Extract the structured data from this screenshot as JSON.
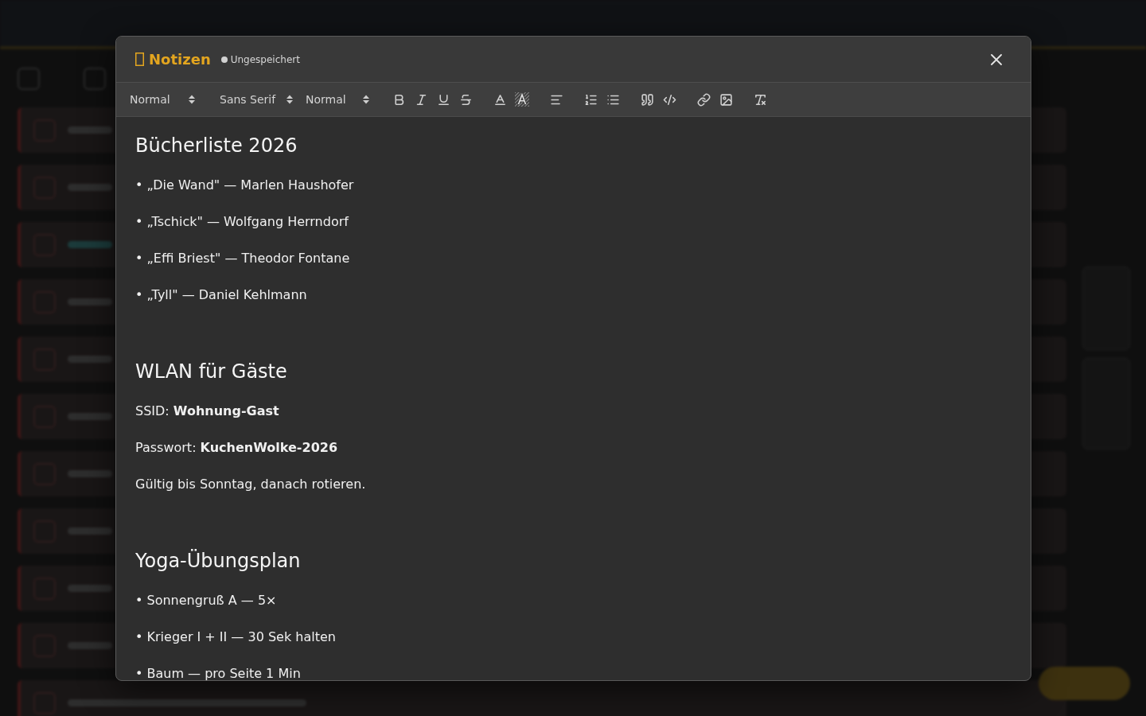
{
  "modal": {
    "title": "Notizen",
    "status": "Ungespeichert",
    "toolbar": {
      "pickers": [
        {
          "kind": "header",
          "value": "Normal"
        },
        {
          "kind": "font",
          "value": "Sans Serif"
        },
        {
          "kind": "size",
          "value": "Normal"
        }
      ]
    },
    "content": [
      {
        "kind": "heading",
        "text": "Bücherliste 2026"
      },
      {
        "kind": "paragraph",
        "text": "• „Die Wand\" — Marlen Haushofer"
      },
      {
        "kind": "paragraph",
        "text": "• „Tschick\" — Wolfgang Herrndorf"
      },
      {
        "kind": "paragraph",
        "text": "• „Effi Briest\" — Theodor Fontane"
      },
      {
        "kind": "paragraph",
        "text": "• „Tyll\" — Daniel Kehlmann"
      },
      {
        "kind": "empty"
      },
      {
        "kind": "heading",
        "text": "WLAN für Gäste"
      },
      {
        "kind": "paragraph",
        "text": "SSID: **Wohnung-Gast**"
      },
      {
        "kind": "paragraph",
        "text": "Passwort: **KuchenWolke-2026**"
      },
      {
        "kind": "paragraph",
        "text": "Gültig bis Sonntag, danach rotieren."
      },
      {
        "kind": "empty"
      },
      {
        "kind": "heading",
        "text": "Yoga-Übungsplan"
      },
      {
        "kind": "paragraph",
        "text": "• Sonnengruß A — 5×"
      },
      {
        "kind": "paragraph",
        "text": "• Krieger I + II — 30 Sek halten"
      },
      {
        "kind": "paragraph",
        "text": "• Baum — pro Seite 1 Min"
      }
    ]
  }
}
